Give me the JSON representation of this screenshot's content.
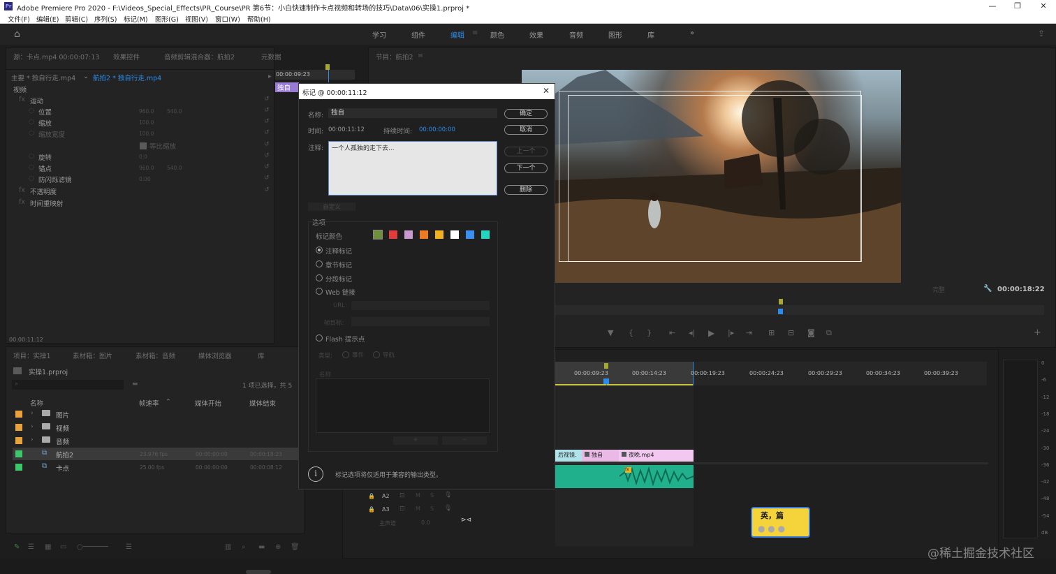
{
  "window": {
    "app_icon": "Pr",
    "title": "Adobe Premiere Pro 2020 - F:\\Videos_Special_Effects\\PR_Course\\PR 第6节：小白快速制作卡点视频和转场的技巧\\Data\\06\\实操1.prproj *",
    "minimize": "—",
    "maximize": "❐",
    "close": "✕"
  },
  "menu": [
    "文件(F)",
    "编辑(E)",
    "剪辑(C)",
    "序列(S)",
    "标记(M)",
    "图形(G)",
    "视图(V)",
    "窗口(W)",
    "帮助(H)"
  ],
  "workspaces": [
    "学习",
    "组件",
    "编辑",
    "颜色",
    "效果",
    "音频",
    "图形",
    "库"
  ],
  "workspace_active": "编辑",
  "workspace_more": "»",
  "effect_controls": {
    "tabs": [
      "源：卡点.mp4 00:00:07:13",
      "效果控件",
      "音频剪辑混合器：航拍2",
      "元数据"
    ],
    "clip_path": "主要 * 独自行走.mp4",
    "clip_seq": "航拍2 * 独自行走.mp4",
    "timecode_top": "00:00:09:23",
    "clip_bar": "独自",
    "section_video": "视频",
    "rows": [
      {
        "label": "运动",
        "fx": "fx",
        "vals": []
      },
      {
        "label": "位置",
        "vals": [
          "960.0",
          "540.0"
        ]
      },
      {
        "label": "缩放",
        "vals": [
          "100.0"
        ]
      },
      {
        "label": "缩放宽度",
        "vals": [
          "100.0"
        ]
      },
      {
        "label": "等比缩放",
        "vals": []
      },
      {
        "label": "旋转",
        "vals": [
          "0.0"
        ]
      },
      {
        "label": "锚点",
        "vals": [
          "960.0",
          "540.0"
        ]
      },
      {
        "label": "防闪烁滤镜",
        "vals": [
          "0.00"
        ]
      },
      {
        "label": "不透明度",
        "fx": "fx",
        "vals": []
      },
      {
        "label": "时间重映射",
        "fx": "fx",
        "vals": []
      }
    ],
    "timecode_bottom": "00:00:11:12"
  },
  "program": {
    "tab": "节目：航拍2",
    "fit_select": "完整",
    "timecode": "00:00:18:22"
  },
  "marker_dialog": {
    "title": "标记 @ 00:00:11:12",
    "name_label": "名称:",
    "name_value": "独自",
    "time_label": "时间:",
    "time_value": "00:00:11:12",
    "duration_label": "持续时间:",
    "duration_value": "00:00:00:00",
    "comment_label": "注释:",
    "comment_value": "一个人孤独的走下去...",
    "ok": "确定",
    "cancel": "取消",
    "prev": "上一个",
    "next": "下一个",
    "delete": "删除",
    "custom": "自定义",
    "options_label": "选项",
    "color_label": "标记颜色",
    "colors": [
      "#6f8f3c",
      "#e03c3c",
      "#c89ad0",
      "#ee7a22",
      "#f0b020",
      "#ffffff",
      "#3c8ef0",
      "#22d6c2"
    ],
    "types": [
      "注释标记",
      "章节标记",
      "分段标记",
      "Web 链接"
    ],
    "url_label": "URL:",
    "frame_target_label": "帧目标:",
    "flash": "Flash 提示点",
    "flash_type": "类型:",
    "flash_event": "事件",
    "flash_nav": "导航",
    "param_name": "名称",
    "info": "标记选项将仅适用于兼容的输出类型。"
  },
  "project": {
    "tabs": [
      "项目：实操1",
      "素材箱：图片",
      "素材箱：音频",
      "媒体浏览器",
      "库"
    ],
    "name": "实操1.prproj",
    "selection": "1 项已选择，共 5",
    "columns": [
      "名称",
      "帧速率",
      "媒体开始",
      "媒体结束"
    ],
    "items": [
      {
        "color": "#e8a33c",
        "type": "folder",
        "name": "图片",
        "fps": "",
        "start": "",
        "end": ""
      },
      {
        "color": "#e8a33c",
        "type": "folder",
        "name": "视频",
        "fps": "",
        "start": "",
        "end": ""
      },
      {
        "color": "#e8a33c",
        "type": "folder",
        "name": "音频",
        "fps": "",
        "start": "",
        "end": ""
      },
      {
        "color": "#3cc86a",
        "type": "sequence",
        "name": "航拍2",
        "fps": "23.976 fps",
        "start": "00:00:00:00",
        "end": "00:00:18:23"
      },
      {
        "color": "#3cc86a",
        "type": "sequence",
        "name": "卡点",
        "fps": "25.00 fps",
        "start": "00:00:00:00",
        "end": "00:00:08:12"
      }
    ]
  },
  "timeline": {
    "ruler": [
      "00:00:09:23",
      "00:00:14:23",
      "00:00:19:23",
      "00:00:24:23",
      "00:00:29:23",
      "00:00:34:23",
      "00:00:39:23"
    ],
    "clips_v": [
      "后视镜.",
      "独自",
      "夜晚.mp4"
    ],
    "tracks": [
      "A2",
      "A3"
    ],
    "master": "主声道",
    "master_val": "0.0",
    "sticker": "英，篇"
  },
  "meter_ticks": [
    "0",
    "-6",
    "-12",
    "-18",
    "-24",
    "-30",
    "-36",
    "-42",
    "-48",
    "-54",
    "dB"
  ],
  "watermark": "@稀土掘金技术社区"
}
